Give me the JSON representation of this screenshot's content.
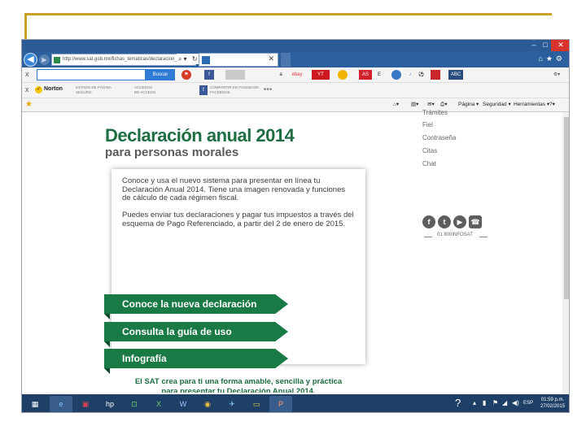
{
  "browser": {
    "address": "http://www.sat.gob.mx/fichas_tematicas/declaracion_",
    "tab_title": "",
    "search_button": "Buscar",
    "menu_commands": [
      "Página",
      "Seguridad",
      "Herramientas"
    ],
    "toolbar_badges": [
      "ABC"
    ]
  },
  "toolbar2": {
    "norton_label": "Norton",
    "estado_label": "ESTADO DE PÁGINA",
    "estado_value": "SEGURO",
    "accesos_label": "ACCESOS",
    "accesos_value": "DE ACCESO",
    "share_label": "COMPARTIR EN FACEBOOK",
    "share_value": "FACEBOOK"
  },
  "page": {
    "title": "Declaración anual 2014",
    "subtitle": "para personas morales",
    "paragraph1": "Conoce y usa el nuevo sistema para presentar en línea tu Declaración Anual 2014. Tiene una imagen renovada y funciones de cálculo de cada régimen fiscal.",
    "paragraph2": "Puedes enviar tus declaraciones y pagar tus impuestos a través del esquema de Pago Referenciado, a partir del 2 de enero de 2015.",
    "buttons": [
      "Conoce la nueva declaración",
      "Consulta la guía de uso",
      "Infografía"
    ],
    "tagline1": "El SAT crea para ti una forma amable, sencilla y práctica",
    "tagline2": "para presentar tu Declaración Anual 2014."
  },
  "side_menu": {
    "items": [
      "Trámites",
      "Fiel",
      "Contraseña",
      "Citas",
      "Chat"
    ],
    "social_handle": "01 800INFOSAT"
  },
  "taskbar": {
    "time": "01:59 p.m.",
    "date": "27/02/2015",
    "lang": "ESP"
  },
  "colors": {
    "brand_green": "#1a7a45",
    "titlebar_blue": "#2a5b95",
    "deco_gold": "#c9a227"
  }
}
